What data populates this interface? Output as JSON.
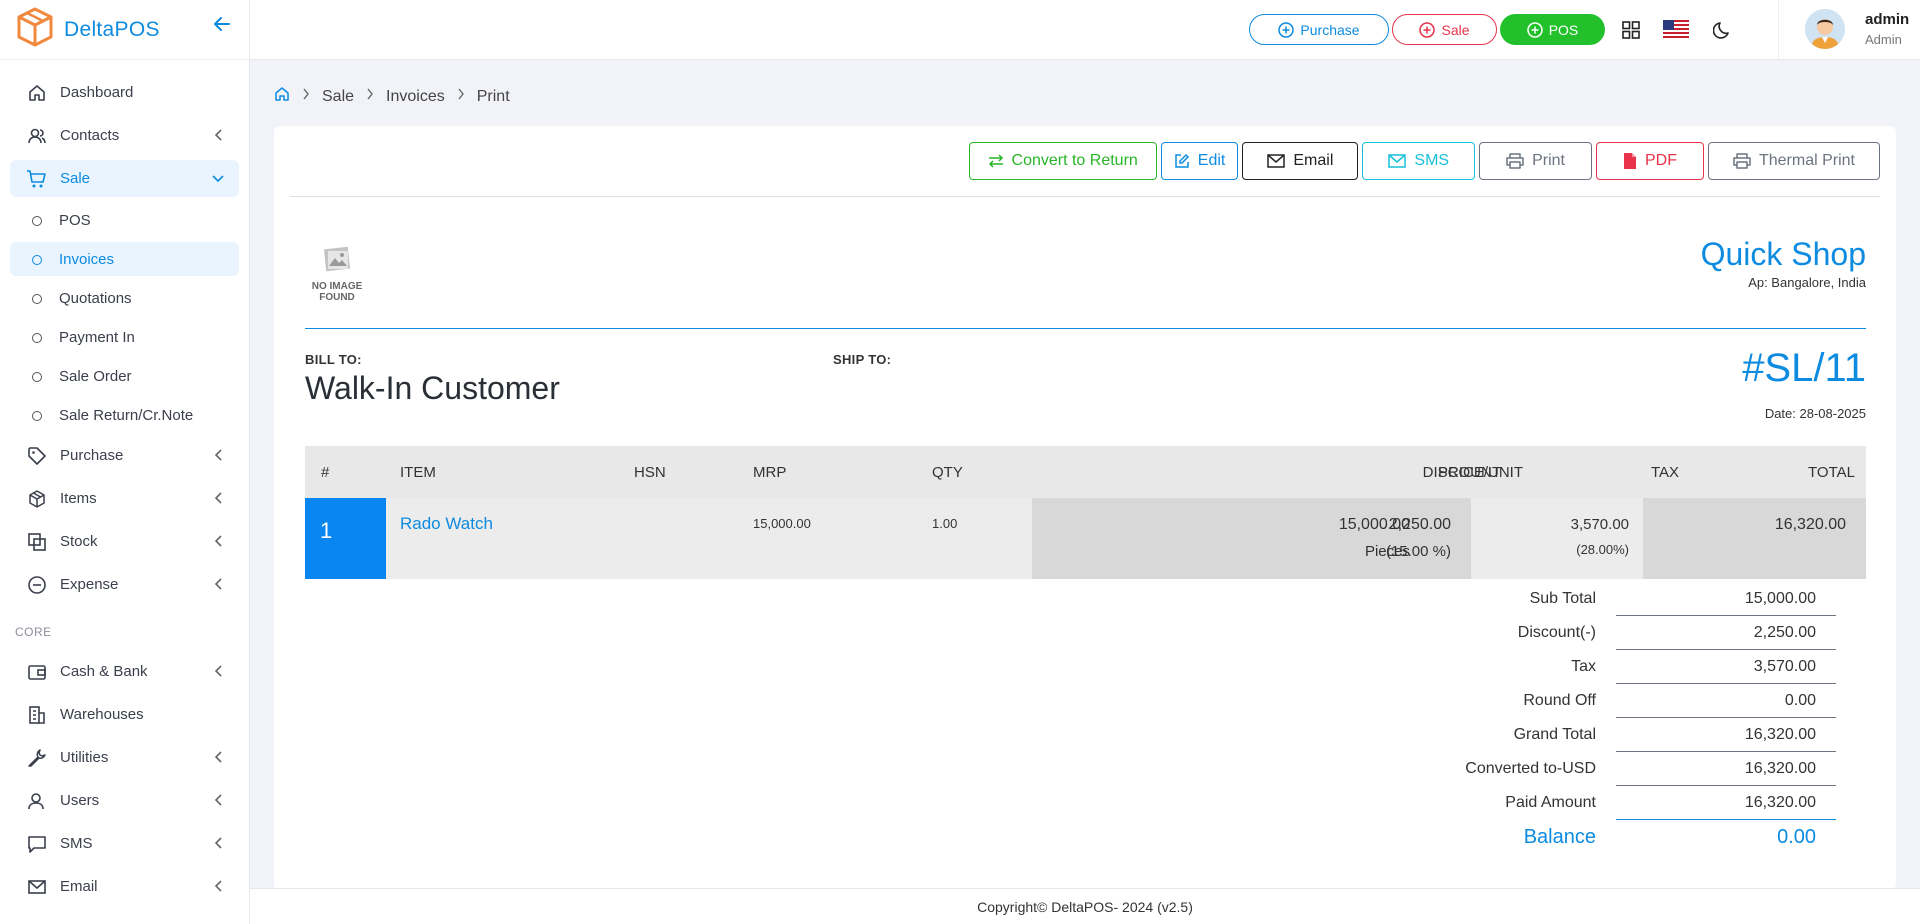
{
  "app": {
    "name": "DeltaPOS"
  },
  "sidebar": {
    "items": [
      {
        "label": "Dashboard"
      },
      {
        "label": "Contacts"
      },
      {
        "label": "Sale"
      },
      {
        "label": "Purchase"
      },
      {
        "label": "Items"
      },
      {
        "label": "Stock"
      },
      {
        "label": "Expense"
      }
    ],
    "sale_sub": [
      {
        "label": "POS"
      },
      {
        "label": "Invoices"
      },
      {
        "label": "Quotations"
      },
      {
        "label": "Payment In"
      },
      {
        "label": "Sale Order"
      },
      {
        "label": "Sale Return/Cr.Note"
      }
    ],
    "section_core": "CORE",
    "core_items": [
      {
        "label": "Cash & Bank"
      },
      {
        "label": "Warehouses"
      },
      {
        "label": "Utilities"
      },
      {
        "label": "Users"
      },
      {
        "label": "SMS"
      },
      {
        "label": "Email"
      }
    ]
  },
  "topbar": {
    "purchase": "Purchase",
    "sale": "Sale",
    "pos": "POS",
    "user_name": "admin",
    "user_role": "Admin"
  },
  "breadcrumb": [
    "Sale",
    "Invoices",
    "Print"
  ],
  "actions": {
    "convert": "Convert to Return",
    "edit": "Edit",
    "email": "Email",
    "sms": "SMS",
    "print": "Print",
    "pdf": "PDF",
    "thermal": "Thermal Print"
  },
  "invoice": {
    "no_image_line1": "NO IMAGE",
    "no_image_line2": "FOUND",
    "shop_name": "Quick Shop",
    "shop_address": "Ap: Bangalore, India",
    "bill_to_label": "BILL TO:",
    "ship_to_label": "SHIP TO:",
    "customer": "Walk-In Customer",
    "number": "#SL/11",
    "date": "Date: 28-08-2025"
  },
  "table": {
    "headers": [
      "#",
      "ITEM",
      "HSN",
      "MRP",
      "QTY",
      "PRICE/UNIT",
      "DISCOUNT",
      "TAX",
      "TOTAL"
    ],
    "rows": [
      {
        "num": "1",
        "item": "Rado Watch",
        "hsn": "",
        "mrp": "15,000.00",
        "qty": "1.00",
        "price": "15,000.00",
        "unit": "Pieces",
        "discount": "2,250.00",
        "discount_pct": "(15.00 %)",
        "tax": "3,570.00",
        "tax_pct": "(28.00%)",
        "total": "16,320.00"
      }
    ]
  },
  "totals": [
    {
      "label": "Sub Total",
      "value": "15,000.00"
    },
    {
      "label": "Discount(-)",
      "value": "2,250.00"
    },
    {
      "label": "Tax",
      "value": "3,570.00"
    },
    {
      "label": "Round Off",
      "value": "0.00"
    },
    {
      "label": "Grand Total",
      "value": "16,320.00"
    },
    {
      "label": "Converted to-USD",
      "value": "16,320.00"
    },
    {
      "label": "Paid Amount",
      "value": "16,320.00"
    }
  ],
  "balance": {
    "label": "Balance",
    "value": "0.00"
  },
  "footer": "Copyright© DeltaPOS- 2024 (v2.5)",
  "colors": {
    "accent": "#0d8be0",
    "green": "#28b528",
    "red": "#e8334a",
    "cyan": "#17c1d8"
  }
}
